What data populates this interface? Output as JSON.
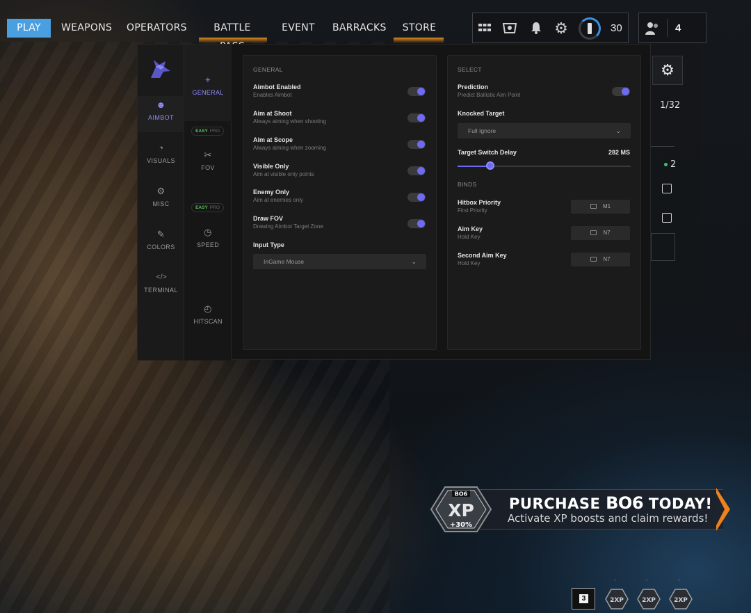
{
  "topnav": {
    "tabs": [
      {
        "label": "PLAY",
        "active": true
      },
      {
        "label": "WEAPONS",
        "active": false
      },
      {
        "label": "OPERATORS",
        "active": false
      },
      {
        "label": "BATTLE PASS",
        "active": false
      },
      {
        "label": "EVENT",
        "active": false
      },
      {
        "label": "BARRACKS",
        "active": false
      },
      {
        "label": "STORE",
        "active": false
      }
    ],
    "hud": {
      "icons": [
        "grid-icon",
        "theater-icon",
        "bell-icon",
        "gear-icon"
      ],
      "ammo_count": "30",
      "party_count": "4"
    }
  },
  "sidebar": {
    "items": [
      {
        "label": "AIMBOT",
        "icon": "aimbot-icon",
        "active": true
      },
      {
        "label": "VISUALS",
        "icon": "visuals-icon",
        "active": false
      },
      {
        "label": "MISC",
        "icon": "misc-icon",
        "active": false
      },
      {
        "label": "COLORS",
        "icon": "colors-icon",
        "active": false
      },
      {
        "label": "TERMINAL",
        "icon": "terminal-icon",
        "active": false
      }
    ]
  },
  "subnav": {
    "items": [
      {
        "label": "GENERAL",
        "icon": "crosshair-icon",
        "active": true
      },
      {
        "label": "FOV",
        "icon": "fov-icon",
        "active": false
      },
      {
        "label": "SPEED",
        "icon": "speed-icon",
        "active": false
      },
      {
        "label": "HITSCAN",
        "icon": "hitscan-icon",
        "active": false
      }
    ],
    "mode": {
      "easy": "EASY",
      "pro": "PRO"
    }
  },
  "general": {
    "heading": "GENERAL",
    "options": [
      {
        "title": "Aimbot Enabled",
        "sub": "Enables Aimbot",
        "enabled": true
      },
      {
        "title": "Aim at Shoot",
        "sub": "Always aiming when shooting",
        "enabled": true
      },
      {
        "title": "Aim at Scope",
        "sub": "Always aiming when zooming",
        "enabled": true
      },
      {
        "title": "Visible Only",
        "sub": "Aim at visible only points",
        "enabled": true
      },
      {
        "title": "Enemy Only",
        "sub": "Aim at enemies only",
        "enabled": true
      },
      {
        "title": "Draw FOV",
        "sub": "Drawing Aimbot Target Zone",
        "enabled": true
      }
    ],
    "input_type": {
      "label": "Input Type",
      "value": "InGame Mouse"
    }
  },
  "select": {
    "heading": "SELECT",
    "prediction": {
      "title": "Prediction",
      "sub": "Predict Ballistic Aim Point",
      "enabled": true
    },
    "knocked_target": {
      "label": "Knocked Target",
      "value": "Full Ignore"
    },
    "switch_delay": {
      "label": "Target Switch Delay",
      "value": "282 MS",
      "fraction": 0.19
    },
    "binds_heading": "BINDS",
    "binds": [
      {
        "title": "Hitbox Priority",
        "sub": "First Priority",
        "key": "M1"
      },
      {
        "title": "Aim Key",
        "sub": "Hold Key",
        "key": "N7"
      },
      {
        "title": "Second Aim Key",
        "sub": "Hold Key",
        "key": "N7"
      }
    ]
  },
  "game_panel": {
    "players": "1/32",
    "count": "2"
  },
  "promo": {
    "title_a": "PURCHASE",
    "title_brand": "BO6",
    "title_b": "TODAY!",
    "subtitle": "Activate XP boosts and claim rewards!",
    "badge_brand": "BO6",
    "badge_xp": "XP",
    "badge_bonus": "+30%"
  },
  "tokens": {
    "count": "3",
    "labels": [
      "2XP",
      "2XP",
      "2XP"
    ]
  },
  "colors": {
    "accent": "#6e6bf2",
    "nav_active": "#4a9fe0",
    "easy": "#57c257",
    "promo_orange": "#f0821c"
  }
}
